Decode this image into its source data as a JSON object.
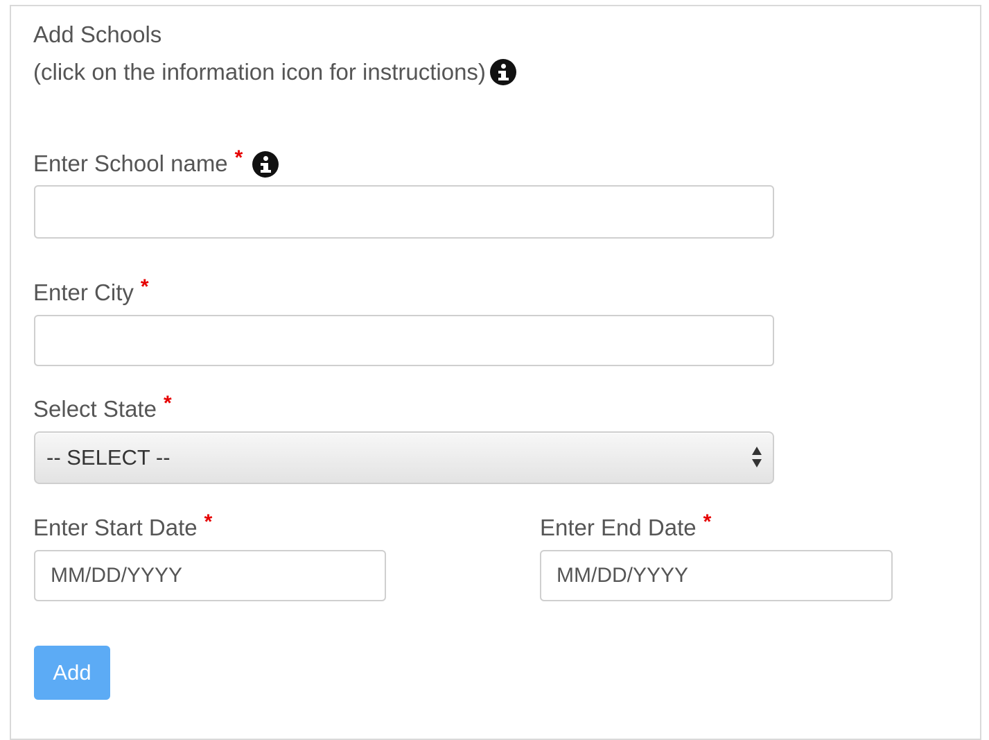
{
  "form": {
    "title": "Add Schools",
    "subtitle": "(click on the information icon for instructions)",
    "school_name": {
      "label": "Enter School name",
      "required_mark": "*",
      "value": "",
      "placeholder": ""
    },
    "city": {
      "label": "Enter City",
      "required_mark": "*",
      "value": "",
      "placeholder": ""
    },
    "state": {
      "label": "Select State",
      "required_mark": "*",
      "selected": "-- SELECT --"
    },
    "start_date": {
      "label": "Enter Start Date",
      "required_mark": "*",
      "placeholder": "MM/DD/YYYY"
    },
    "end_date": {
      "label": "Enter End Date",
      "required_mark": "*",
      "placeholder": "MM/DD/YYYY"
    },
    "add_button_label": "Add"
  },
  "icons": {
    "instructions_icon": "info-circle-icon",
    "school_name_info_icon": "info-circle-icon",
    "select_arrows_icon": "up-down-arrows-icon"
  },
  "colors": {
    "required": "#e60000",
    "button": "#5cabf5",
    "border": "#cfcfcf",
    "text": "#555555"
  }
}
